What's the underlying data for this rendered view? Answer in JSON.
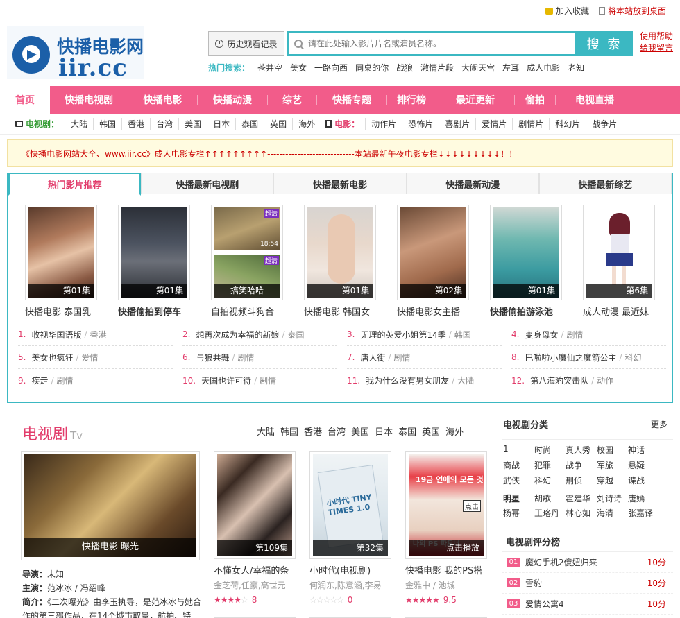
{
  "topbar": {
    "fav": "加入收藏",
    "desktop": "将本站放到桌面"
  },
  "logo": {
    "name": "快播电影网",
    "domain": "iir.cc"
  },
  "header": {
    "history": "历史观看记录",
    "search_placeholder": "请在此处输入影片片名或演员名称。",
    "search_btn": "搜 索",
    "help1": "使用帮助",
    "help2": "给我留言",
    "hot_label": "热门搜索：",
    "hot": [
      "苍井空",
      "美女",
      "一路向西",
      "同桌的你",
      "战狼",
      "激情片段",
      "大闹天宫",
      "左耳",
      "成人电影",
      "老知"
    ]
  },
  "nav": [
    "首页",
    "快播电视剧",
    "快播电影",
    "快播动漫",
    "综艺",
    "快播专题",
    "排行榜",
    "最近更新",
    "偷拍",
    "电视直播"
  ],
  "subnav": {
    "tv_label": "电视剧：",
    "tv": [
      "大陆",
      "韩国",
      "香港",
      "台湾",
      "美国",
      "日本",
      "泰国",
      "英国",
      "海外"
    ],
    "film_label": "电影：",
    "film": [
      "动作片",
      "恐怖片",
      "喜剧片",
      "爱情片",
      "剧情片",
      "科幻片",
      "战争片"
    ]
  },
  "notice": "《快播电影网站大全、www.iir.cc》成人电影专栏↑↑↑↑↑↑↑↑↑-----------------------------本站最新午夜电影专栏↓↓↓↓↓↓↓↓↓！！",
  "tabs": [
    "热门影片推荐",
    "快播最新电视剧",
    "快播最新电影",
    "快播最新动漫",
    "快播最新综艺"
  ],
  "posters": [
    {
      "cap": "第01集",
      "title": "快播电影 泰国乳"
    },
    {
      "cap": "第01集",
      "title": "快播偷拍到停车"
    },
    {
      "cap": "搞笑哈哈",
      "title": "自拍视频斗狗合",
      "badge1": "超清",
      "badge2": "超清",
      "time": "18:54"
    },
    {
      "cap": "第01集",
      "title": "快播电影 韩国女"
    },
    {
      "cap": "第02集",
      "title": "快播电影女主播"
    },
    {
      "cap": "第01集",
      "title": "快播偷拍游泳池"
    },
    {
      "cap": "第6集",
      "title": "成人动漫 最近妹"
    }
  ],
  "ranks": [
    {
      "n": "1.",
      "t": "收视华国语版",
      "c": "香港"
    },
    {
      "n": "2.",
      "t": "想再次成为幸福的新娘",
      "c": "泰国"
    },
    {
      "n": "3.",
      "t": "无理的英爱小姐第14季",
      "c": "韩国"
    },
    {
      "n": "4.",
      "t": "变身母女",
      "c": "剧情"
    },
    {
      "n": "5.",
      "t": "美女也疯狂",
      "c": "爱情"
    },
    {
      "n": "6.",
      "t": "与狼共舞",
      "c": "剧情"
    },
    {
      "n": "7.",
      "t": "唐人街",
      "c": "剧情"
    },
    {
      "n": "8.",
      "t": "巴啦啦小魔仙之魔箭公主",
      "c": "科幻"
    },
    {
      "n": "9.",
      "t": "疾走",
      "c": "剧情"
    },
    {
      "n": "10.",
      "t": "天国也许可待",
      "c": "剧情"
    },
    {
      "n": "11.",
      "t": "我为什么没有男女朋友",
      "c": "大陆"
    },
    {
      "n": "12.",
      "t": "第八海豹突击队",
      "c": "动作"
    }
  ],
  "tv": {
    "title": "电视剧",
    "sub": "Tv",
    "filters": [
      "大陆",
      "韩国",
      "香港",
      "台湾",
      "美国",
      "日本",
      "泰国",
      "英国",
      "海外"
    ],
    "big": {
      "cap": "快播电影 曝光",
      "dir_l": "导演：",
      "dir": "未知",
      "act_l": "主演：",
      "act": "范冰冰 / 冯绍峰",
      "sum_l": "简介：",
      "sum": "《二次曝光》由李玉执导，是范冰冰与她合作的第三部作品，在14个城市取景，航拍、特"
    },
    "items": [
      {
        "cap": "第109集",
        "t": "不懂女人/幸福的条",
        "a": "金芝荷,任豪,高世元",
        "rating": 4,
        "score": "8"
      },
      {
        "cap": "第32集",
        "t": "小时代(电视剧)",
        "a": "何润东,陈意涵,李易",
        "rating": 0,
        "score": "0",
        "poster_text": "小时代 TINY TIMES 1.0"
      },
      {
        "cap": "点击播放",
        "t": "快播电影 我的PS搭",
        "a": "金雅中 / 池城",
        "rating": 5,
        "score": "9.5",
        "poster_text": "19금 연애의 모든 것",
        "poster_text2": "나의 PS 파트너",
        "badge": "点击"
      }
    ]
  },
  "side": {
    "cat_title": "电视剧分类",
    "more": "更多",
    "cats": [
      "1",
      "时尚",
      "真人秀",
      "校园",
      "神话",
      "商战",
      "犯罪",
      "战争",
      "军旅",
      "悬疑",
      "武侠",
      "科幻",
      "刑侦",
      "穿越",
      "谍战"
    ],
    "stars": [
      "明星",
      "胡歌",
      "霍建华",
      "刘诗诗",
      "唐嫣",
      "杨幂",
      "王珞丹",
      "林心如",
      "海清",
      "张嘉译"
    ],
    "rate_title": "电视剧评分榜",
    "rate": [
      {
        "no": "01",
        "t": "魔幻手机2傻妞归来",
        "s": "10分"
      },
      {
        "no": "02",
        "t": "雪豹",
        "s": "10分"
      },
      {
        "no": "03",
        "t": "爱情公寓4",
        "s": "10分"
      }
    ]
  },
  "colors": {
    "accent": "#f25c8a",
    "teal": "#3bb8c2",
    "pink_text": "#e23c6b"
  }
}
